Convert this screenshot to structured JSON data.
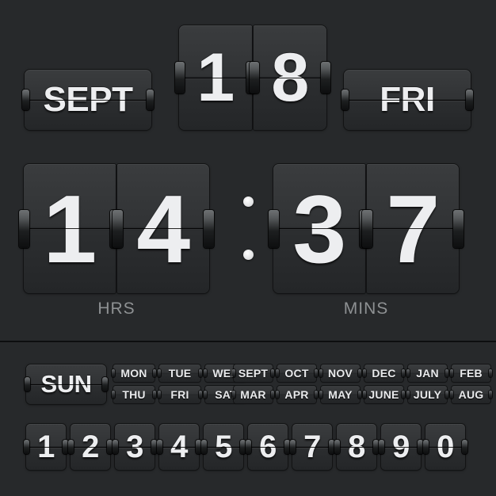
{
  "widget": {
    "name": "flip-clock-calendar",
    "background_color": "#27292b",
    "card_color": "#313335",
    "text_color": "#edeef0",
    "label_color": "#8e9193"
  },
  "top_row": {
    "month": "SEPT",
    "date_digits": [
      "1",
      "8"
    ],
    "weekday": "FRI"
  },
  "clock": {
    "hours_digits": [
      "1",
      "4"
    ],
    "minutes_digits": [
      "3",
      "7"
    ],
    "hours_label": "HRS",
    "minutes_label": "MINS",
    "separator": "colon-dots"
  },
  "chips": {
    "selected_day": "SUN",
    "days": [
      "MON",
      "THU",
      "TUE",
      "FRI",
      "WED",
      "SAT"
    ],
    "months": [
      "SEPT",
      "MAR",
      "OCT",
      "APR",
      "NOV",
      "MAY",
      "DEC",
      "JUNE",
      "JAN",
      "JULY",
      "FEB",
      "AUG"
    ]
  },
  "digits": [
    "1",
    "2",
    "3",
    "4",
    "5",
    "6",
    "7",
    "8",
    "9",
    "0"
  ]
}
